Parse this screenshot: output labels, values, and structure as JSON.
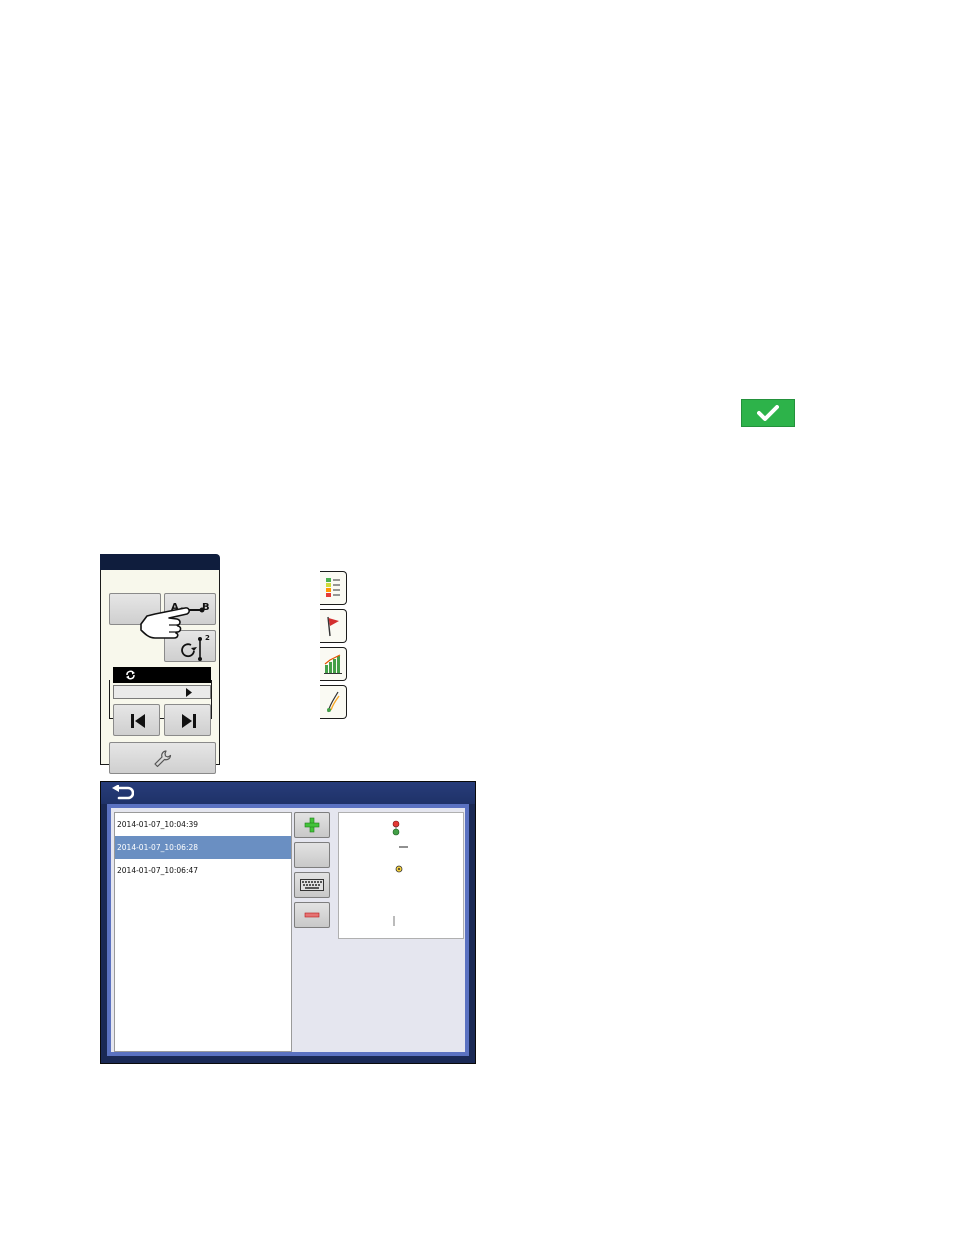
{
  "accept_button": {
    "icon": "checkmark-icon",
    "color": "#2db34a"
  },
  "guidance_panel": {
    "ab_button": {
      "point_a": "A",
      "point_b": "B"
    },
    "cycle_button": {
      "superscript": "2"
    },
    "tabs": [
      {
        "icon": "legend-icon"
      },
      {
        "icon": "flag-icon"
      },
      {
        "icon": "bar-chart-icon"
      },
      {
        "icon": "guidance-icon"
      }
    ]
  },
  "list_window": {
    "files": [
      {
        "name": "2014-01-07_10:04:39",
        "selected": false
      },
      {
        "name": "2014-01-07_10:06:28",
        "selected": true
      },
      {
        "name": "2014-01-07_10:06:47",
        "selected": false
      }
    ],
    "buttons": [
      {
        "icon": "add-icon"
      },
      {
        "icon": "blank"
      },
      {
        "icon": "keyboard-icon"
      },
      {
        "icon": "remove-icon"
      }
    ]
  }
}
